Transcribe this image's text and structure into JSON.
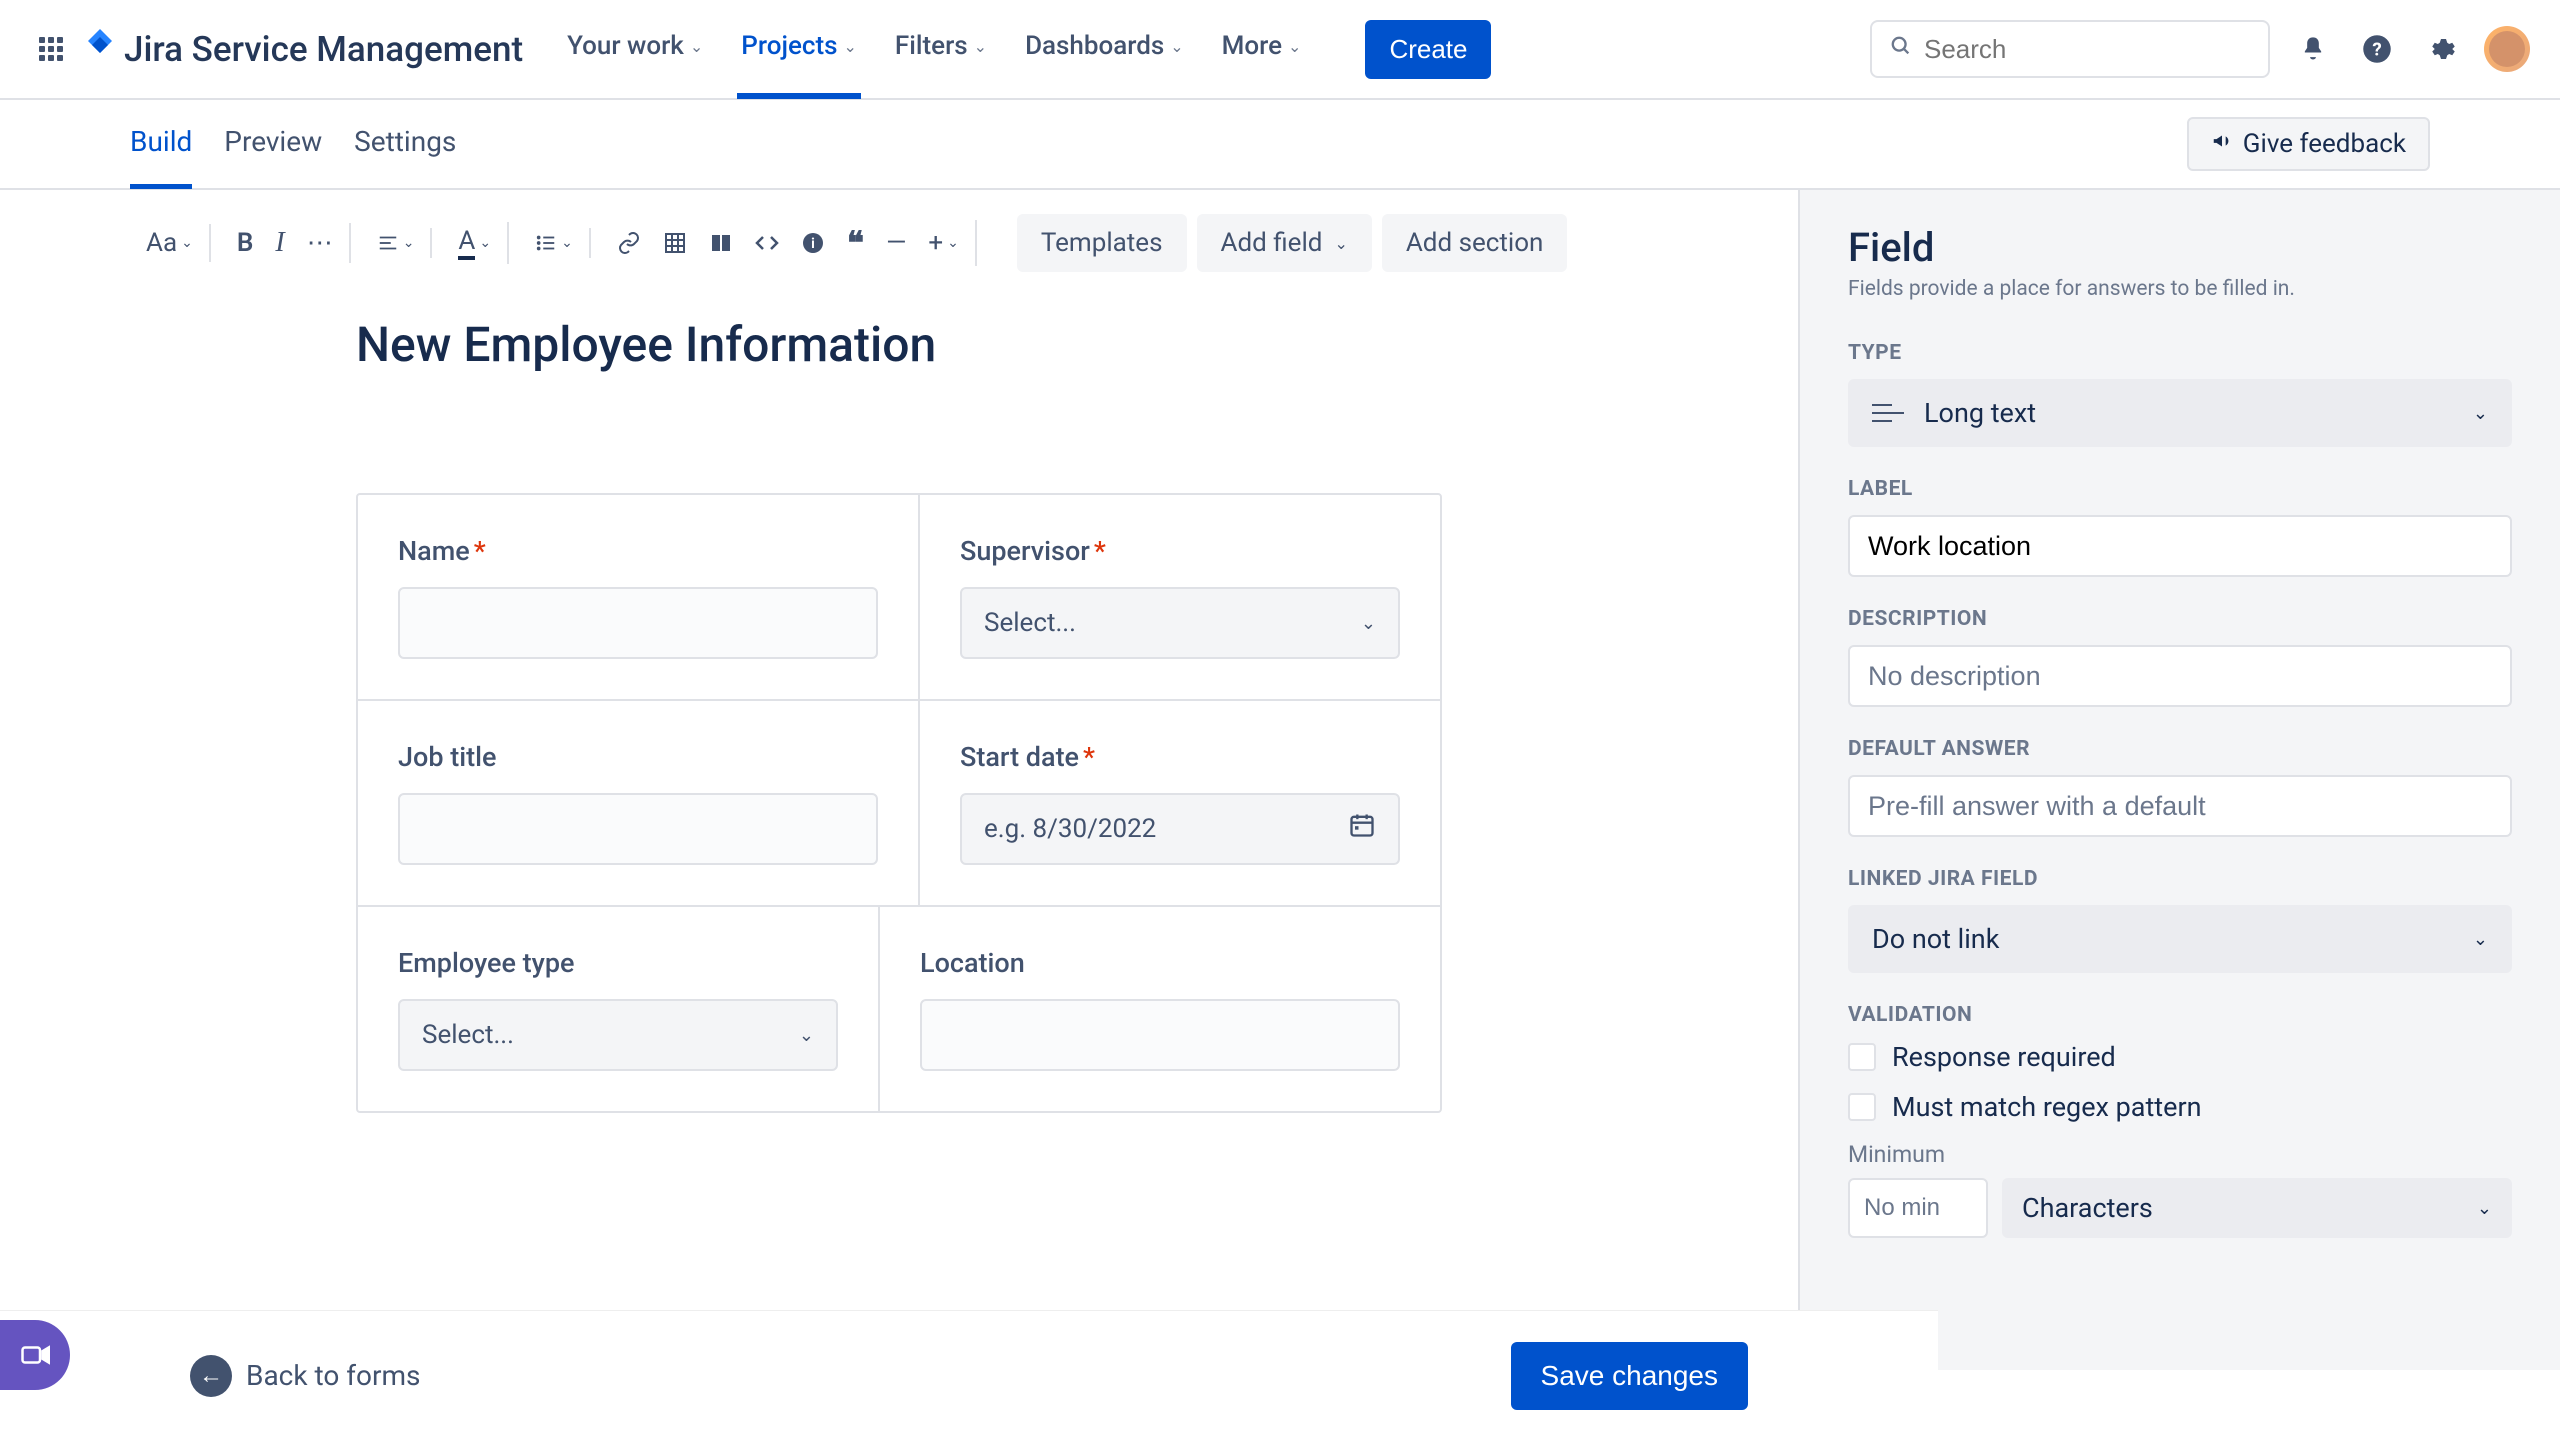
{
  "header": {
    "product": "Jira Service Management",
    "nav": {
      "your_work": "Your work",
      "projects": "Projects",
      "filters": "Filters",
      "dashboards": "Dashboards",
      "more": "More"
    },
    "create": "Create",
    "search_placeholder": "Search"
  },
  "tabs": {
    "build": "Build",
    "preview": "Preview",
    "settings": "Settings",
    "feedback": "Give feedback"
  },
  "toolbar": {
    "text_style": "Aa",
    "templates": "Templates",
    "add_field": "Add field",
    "add_section": "Add section"
  },
  "form": {
    "title": "New Employee Information",
    "fields": {
      "name": {
        "label": "Name"
      },
      "supervisor": {
        "label": "Supervisor",
        "placeholder": "Select..."
      },
      "job_title": {
        "label": "Job title"
      },
      "start_date": {
        "label": "Start date",
        "placeholder": "e.g. 8/30/2022"
      },
      "employee_type": {
        "label": "Employee type",
        "placeholder": "Select..."
      },
      "location": {
        "label": "Location"
      }
    }
  },
  "bottom": {
    "back": "Back to forms",
    "save": "Save changes"
  },
  "panel": {
    "title": "Field",
    "desc": "Fields provide a place for answers to be filled in.",
    "type_label": "TYPE",
    "type_value": "Long text",
    "label_label": "LABEL",
    "label_value": "Work location",
    "description_label": "DESCRIPTION",
    "description_placeholder": "No description",
    "default_label": "DEFAULT ANSWER",
    "default_placeholder": "Pre-fill answer with a default",
    "linked_label": "LINKED JIRA FIELD",
    "linked_value": "Do not link",
    "validation_label": "VALIDATION",
    "required": "Response required",
    "regex": "Must match regex pattern",
    "minimum_label": "Minimum",
    "minimum_placeholder": "No min",
    "minimum_unit": "Characters"
  }
}
